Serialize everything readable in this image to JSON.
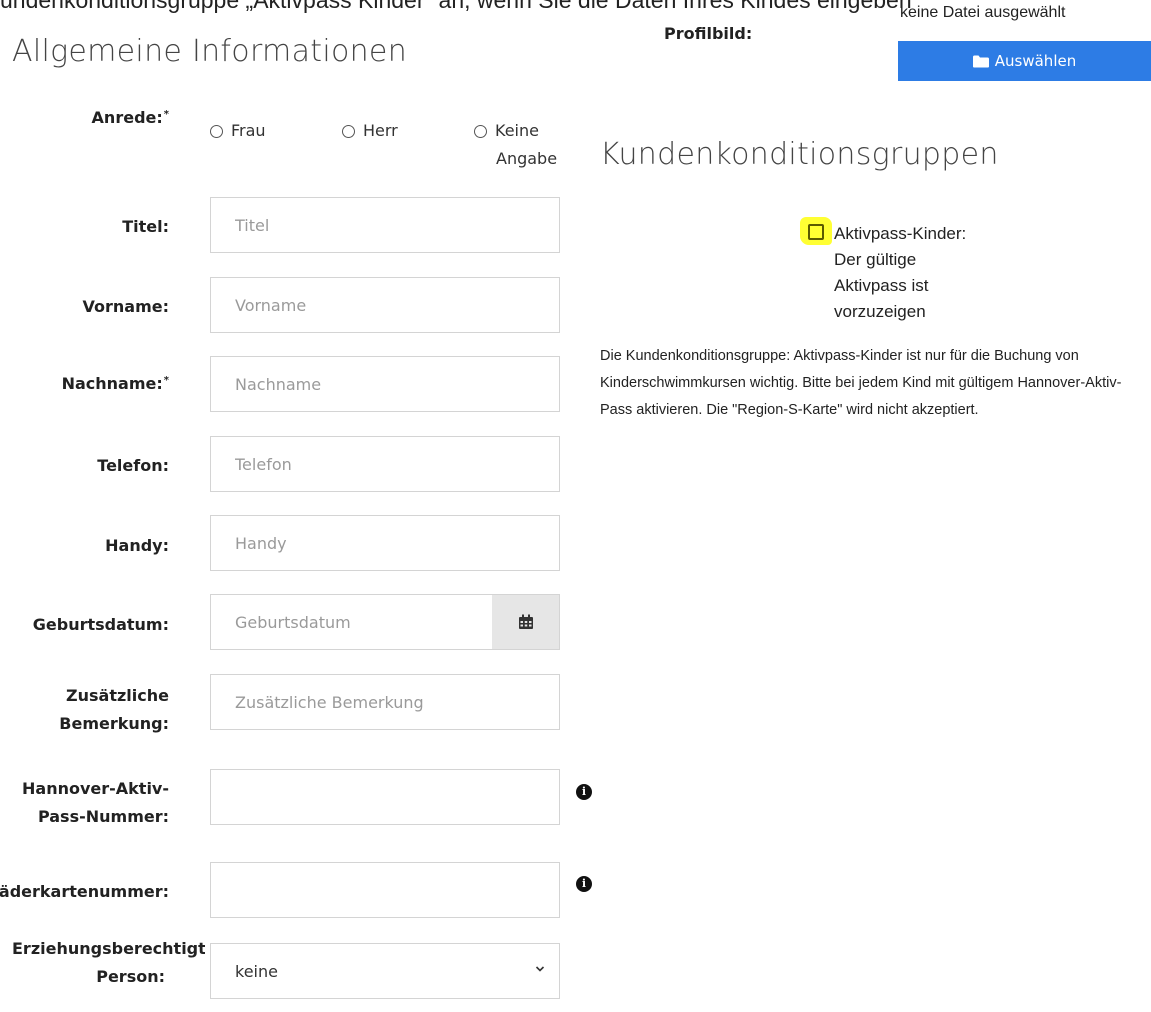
{
  "top_text": "undenkonditionsgruppe „Aktivpass Kinder“ an, wenn Sie die Daten Ihres Kindes eingeben",
  "general": {
    "title": "Allgemeine Informationen",
    "anrede_label": "Anrede:",
    "required_mark": "*",
    "radio_options": [
      "Frau",
      "Herr",
      "Keine Angabe"
    ],
    "radio_keine_line1": "Keine",
    "radio_keine_line2": "Angabe",
    "fields": {
      "titel": {
        "label": "Titel:",
        "placeholder": "Titel",
        "value": ""
      },
      "vorname": {
        "label": "Vorname:",
        "placeholder": "Vorname",
        "value": ""
      },
      "nachname": {
        "label": "Nachname:",
        "placeholder": "Nachname",
        "value": ""
      },
      "telefon": {
        "label": "Telefon:",
        "placeholder": "Telefon",
        "value": ""
      },
      "handy": {
        "label": "Handy:",
        "placeholder": "Handy",
        "value": ""
      },
      "geburtsdatum": {
        "label": "Geburtsdatum:",
        "placeholder": "Geburtsdatum",
        "value": ""
      },
      "bemerkung": {
        "label_line1": "Zusätzliche",
        "label_line2": "Bemerkung:",
        "placeholder": "Zusätzliche Bemerkung",
        "value": ""
      },
      "aktivpass": {
        "label_line1": "Hannover-Aktiv-",
        "label_line2": "Pass-Nummer:",
        "value": ""
      },
      "baederkarte": {
        "label": "Bäderkartenummer:",
        "value": ""
      },
      "erziehung": {
        "label_line1": "Erziehungsberechtigt",
        "label_line2": "Person:",
        "selected": "keine"
      }
    }
  },
  "profile": {
    "label": "Profilbild:",
    "file_status": "keine Datei ausgewählt",
    "button_label": "Auswählen"
  },
  "conditions": {
    "title": "Kundenkonditionsgruppen",
    "checkbox_lines": [
      "Aktivpass-Kinder:",
      "Der gültige",
      "Aktivpass ist",
      "vorzuzeigen"
    ],
    "note": "Die Kundenkonditionsgruppe: Aktivpass-Kinder ist nur für die Buchung von Kinderschwimmkursen wichtig. Bitte bei jedem Kind mit gültigem Hannover-Aktiv-Pass aktivieren. Die \"Region-S-Karte\" wird nicht akzeptiert."
  },
  "colors": {
    "primary": "#2d7ce5",
    "highlight": "#ffff33"
  },
  "icons": {
    "calendar": "calendar-icon",
    "info": "info-icon",
    "folder": "folder-icon",
    "chevron": "chevron-down-icon"
  }
}
